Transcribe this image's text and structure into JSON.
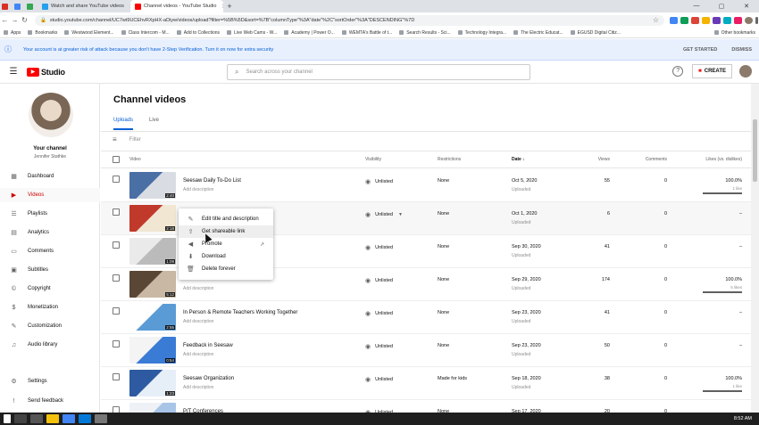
{
  "browser": {
    "tabs": [
      {
        "label": "",
        "fav": "#d93025",
        "small": true
      },
      {
        "label": "",
        "fav": "#4285f4",
        "small": true
      },
      {
        "label": "",
        "fav": "#34a853",
        "small": true
      },
      {
        "label": "Watch and share YouTube videos",
        "fav": "#24a0ed",
        "small": false,
        "active": false
      },
      {
        "label": "Channel videos - YouTube Studio",
        "fav": "#ff0000",
        "small": false,
        "active": true
      }
    ],
    "new_tab": "+",
    "url": "studio.youtube.com/channel/UC7wt9UCEhvRXpHX-aDiyw/videos/upload?filter=%5B%5D&sort=%7B\"columnType\"%3A\"date\"%2C\"sortOrder\"%3A\"DESCENDING\"%7D",
    "bookmarks": [
      "Apps",
      "Bookmarks",
      "Westwood Element...",
      "Class Intercom - M...",
      "Add to Collections",
      "Live Web Cams - W...",
      "Academy | Power O...",
      "WEMTA's Battle of t...",
      "Search Results - Sci...",
      "Technology Integra...",
      "The Electric Educat...",
      "EGUSD Digital Citiz..."
    ],
    "other_bookmarks": "Other bookmarks"
  },
  "banner": {
    "message": "Your account is at greater risk of attack because you don't have 2-Step Verification. Turn it on now for extra security",
    "get_started": "GET STARTED",
    "dismiss": "DISMISS"
  },
  "header": {
    "logo_text": "Studio",
    "search_placeholder": "Search across your channel",
    "create_label": "CREATE"
  },
  "sidebar": {
    "your_channel": "Your channel",
    "channel_name": "Jennifer Stathke",
    "items": [
      {
        "label": "Dashboard",
        "icon": "▦",
        "name": "dashboard"
      },
      {
        "label": "Videos",
        "icon": "▶",
        "name": "videos",
        "active": true
      },
      {
        "label": "Playlists",
        "icon": "☰",
        "name": "playlists"
      },
      {
        "label": "Analytics",
        "icon": "▤",
        "name": "analytics"
      },
      {
        "label": "Comments",
        "icon": "▭",
        "name": "comments"
      },
      {
        "label": "Subtitles",
        "icon": "▣",
        "name": "subtitles"
      },
      {
        "label": "Copyright",
        "icon": "©",
        "name": "copyright"
      },
      {
        "label": "Monetization",
        "icon": "$",
        "name": "monetization"
      },
      {
        "label": "Customization",
        "icon": "✎",
        "name": "customization"
      },
      {
        "label": "Audio library",
        "icon": "♫",
        "name": "audio-library"
      }
    ],
    "bottom": [
      {
        "label": "Settings",
        "icon": "⚙",
        "name": "settings"
      },
      {
        "label": "Send feedback",
        "icon": "!",
        "name": "send-feedback"
      }
    ]
  },
  "main": {
    "title": "Channel videos",
    "tabs": [
      "Uploads",
      "Live"
    ],
    "filter_placeholder": "Filter",
    "columns": [
      "Video",
      "Visibility",
      "Restrictions",
      "Date",
      "Views",
      "Comments",
      "Likes (vs. dislikes)"
    ],
    "rows": [
      {
        "title": "Seesaw Daily To-Do List",
        "desc": "Add description",
        "duration": "2:40",
        "visibility": "Unlisted",
        "restrictions": "None",
        "date": "Oct 5, 2020",
        "date_sub": "Uploaded",
        "views": "55",
        "comments": "0",
        "likes": "100.0%",
        "likes_sub": "1 like",
        "likes_pct": 100,
        "thumb": [
          "#4a6fa5",
          "#d9dde3"
        ]
      },
      {
        "title": "",
        "desc": "",
        "duration": "2:18",
        "visibility": "Unlisted",
        "visibility_dropdown": true,
        "restrictions": "None",
        "date": "Oct 1, 2020",
        "date_sub": "Uploaded",
        "views": "6",
        "comments": "0",
        "likes": "–",
        "likes_sub": "",
        "thumb": [
          "#c0392b",
          "#f0e6d2"
        ]
      },
      {
        "title": "",
        "desc": "",
        "duration": "1:09",
        "visibility": "Unlisted",
        "restrictions": "None",
        "date": "Sep 30, 2020",
        "date_sub": "Uploaded",
        "views": "41",
        "comments": "0",
        "likes": "–",
        "likes_sub": "",
        "thumb": [
          "#eaeaea",
          "#bbbbbb"
        ]
      },
      {
        "title": "",
        "desc": "Add description",
        "duration": "5:12",
        "visibility": "Unlisted",
        "restrictions": "None",
        "date": "Sep 29, 2020",
        "date_sub": "Uploaded",
        "views": "174",
        "comments": "0",
        "likes": "100.0%",
        "likes_sub": "5 likes",
        "likes_pct": 100,
        "thumb": [
          "#5a4634",
          "#c8b8a4"
        ]
      },
      {
        "title": "In Person & Remote Teachers Working Together",
        "desc": "Add description",
        "duration": "2:55",
        "visibility": "Unlisted",
        "restrictions": "None",
        "date": "Sep 23, 2020",
        "date_sub": "Uploaded",
        "views": "41",
        "comments": "0",
        "likes": "–",
        "likes_sub": "",
        "thumb": [
          "#ffffff",
          "#5b9bd5"
        ]
      },
      {
        "title": "Feedback in Seesaw",
        "desc": "Add description",
        "duration": "0:54",
        "visibility": "Unlisted",
        "restrictions": "None",
        "date": "Sep 23, 2020",
        "date_sub": "Uploaded",
        "views": "50",
        "comments": "0",
        "likes": "–",
        "likes_sub": "",
        "thumb": [
          "#f4f4f4",
          "#3a7bd5"
        ]
      },
      {
        "title": "Seesaw Organization",
        "desc": "Add description",
        "duration": "1:23",
        "visibility": "Unlisted",
        "restrictions": "Made for kids",
        "date": "Sep 18, 2020",
        "date_sub": "Uploaded",
        "views": "38",
        "comments": "0",
        "likes": "100.0%",
        "likes_sub": "1 like",
        "likes_pct": 100,
        "thumb": [
          "#2d5aa0",
          "#e6eef8"
        ]
      },
      {
        "title": "P/T Conferences",
        "desc": "",
        "duration": "",
        "visibility": "Unlisted",
        "restrictions": "None",
        "date": "Sep 17, 2020",
        "date_sub": "",
        "views": "20",
        "comments": "0",
        "likes": "",
        "likes_sub": "",
        "thumb": [
          "#eef2f7",
          "#a8c4e6"
        ]
      }
    ]
  },
  "context_menu": {
    "items": [
      {
        "label": "Edit title and description",
        "icon": "✎",
        "name": "edit-title"
      },
      {
        "label": "Get shareable link",
        "icon": "⇪",
        "name": "get-shareable-link",
        "hover": true
      },
      {
        "label": "Promote",
        "icon": "◀",
        "name": "promote",
        "external": "↗"
      },
      {
        "label": "Download",
        "icon": "⬇",
        "name": "download"
      },
      {
        "label": "Delete forever",
        "icon": "🗑",
        "name": "delete-forever"
      }
    ]
  },
  "taskbar": {
    "time": "8:52 AM"
  }
}
